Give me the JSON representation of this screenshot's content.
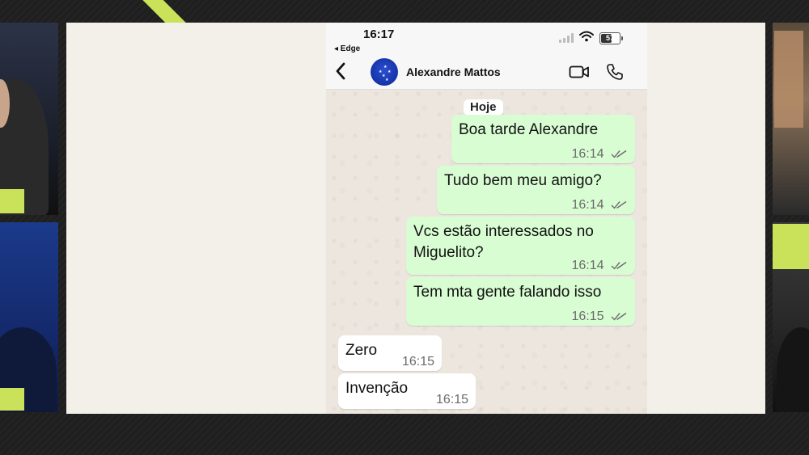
{
  "status_bar": {
    "time": "16:17",
    "back_app": "◂ Edge",
    "battery": "57"
  },
  "chat_header": {
    "contact_name": "Alexandre Mattos"
  },
  "date_separator": "Hoje",
  "messages": [
    {
      "direction": "outgoing",
      "text": "Boa tarde Alexandre",
      "time": "16:14",
      "status": "read"
    },
    {
      "direction": "outgoing",
      "text": "Tudo bem meu amigo?",
      "time": "16:14",
      "status": "read"
    },
    {
      "direction": "outgoing",
      "text_line1": "Vcs estão interessados no",
      "text_line2": "Miguelito?",
      "time": "16:14",
      "status": "read"
    },
    {
      "direction": "outgoing",
      "text": "Tem mta gente falando isso",
      "time": "16:15",
      "status": "read"
    },
    {
      "direction": "incoming",
      "text": "Zero",
      "time": "16:15"
    },
    {
      "direction": "incoming",
      "text": "Invenção",
      "time": "16:15"
    }
  ],
  "icons": {
    "back": "chevron-left-icon",
    "video": "video-camera-icon",
    "call": "phone-icon",
    "signal": "cellular-signal-icon",
    "wifi": "wifi-icon",
    "battery": "battery-icon",
    "read_receipt": "double-check-icon"
  },
  "colors": {
    "outgoing_bubble": "#d9fdd3",
    "incoming_bubble": "#ffffff",
    "chat_background": "#ece5dd",
    "broadcast_accent": "#c9e25a"
  }
}
